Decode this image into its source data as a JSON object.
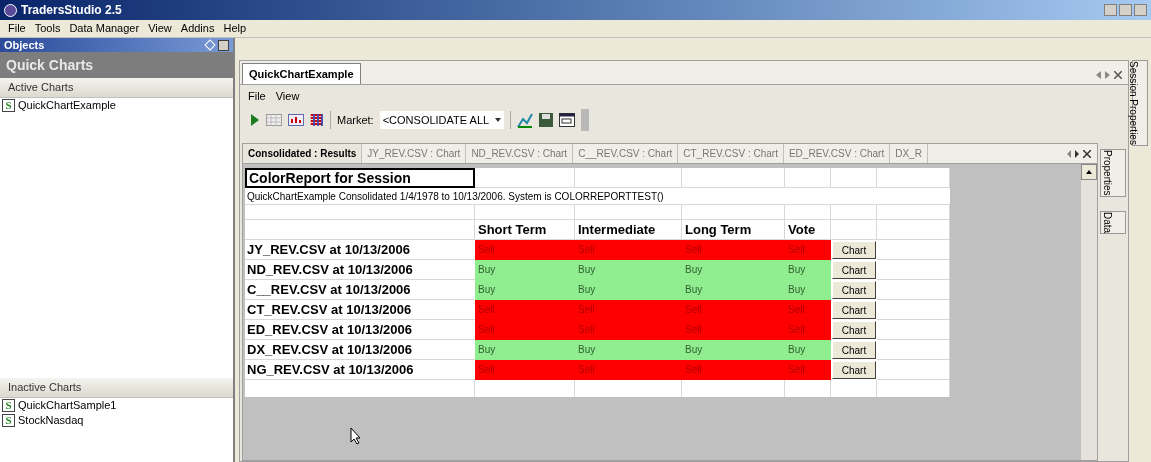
{
  "window": {
    "title": "TradersStudio 2.5"
  },
  "menu": [
    "File",
    "Tools",
    "Data Manager",
    "View",
    "Addins",
    "Help"
  ],
  "objects_panel": {
    "title": "Objects",
    "heading": "Quick Charts",
    "sections": [
      {
        "title": "Active Charts",
        "items": [
          {
            "label": "QuickChartExample",
            "badge": "S"
          }
        ]
      },
      {
        "title": "Inactive Charts",
        "items": [
          {
            "label": "QuickChartSample1",
            "badge": "S"
          },
          {
            "label": "StockNasdaq",
            "badge": "S"
          }
        ]
      }
    ]
  },
  "document_tab": {
    "label": "QuickChartExample",
    "selected": true
  },
  "document_menu": [
    "File",
    "View"
  ],
  "toolbar": {
    "market_label": "Market:",
    "market_value": "<CONSOLIDATE ALL"
  },
  "result_tabs": [
    {
      "label": "Consolidated : Results",
      "selected": true
    },
    {
      "label": "JY_REV.CSV : Chart",
      "selected": false
    },
    {
      "label": "ND_REV.CSV : Chart",
      "selected": false
    },
    {
      "label": "C__REV.CSV : Chart",
      "selected": false
    },
    {
      "label": "CT_REV.CSV : Chart",
      "selected": false
    },
    {
      "label": "ED_REV.CSV : Chart",
      "selected": false
    },
    {
      "label": "DX_R",
      "selected": false
    }
  ],
  "report": {
    "title": "ColorReport for Session",
    "subtitle": "QuickChartExample Consolidated 1/4/1978 to 10/13/2006. System is COLORREPORTTEST()",
    "columns": [
      "Short Term",
      "Intermediate",
      "Long Term",
      "Vote"
    ],
    "rows": [
      {
        "label": "JY_REV.CSV at 10/13/2006",
        "kind": "sell",
        "cells": [
          "Sell",
          "Sell",
          "Sell",
          "Sell"
        ],
        "button": "Chart"
      },
      {
        "label": "ND_REV.CSV at 10/13/2006",
        "kind": "buy",
        "cells": [
          "Buy",
          "Buy",
          "Buy",
          "Buy"
        ],
        "button": "Chart"
      },
      {
        "label": "C__REV.CSV at 10/13/2006",
        "kind": "buy",
        "cells": [
          "Buy",
          "Buy",
          "Buy",
          "Buy"
        ],
        "button": "Chart"
      },
      {
        "label": "CT_REV.CSV at 10/13/2006",
        "kind": "sell",
        "cells": [
          "Sell",
          "Sell",
          "Sell",
          "Sell"
        ],
        "button": "Chart"
      },
      {
        "label": "ED_REV.CSV at 10/13/2006",
        "kind": "sell",
        "cells": [
          "Sell",
          "Sell",
          "Sell",
          "Sell"
        ],
        "button": "Chart"
      },
      {
        "label": "DX_REV.CSV at 10/13/2006",
        "kind": "buy",
        "cells": [
          "Buy",
          "Buy",
          "Buy",
          "Buy"
        ],
        "button": "Chart"
      },
      {
        "label": "NG_REV.CSV at 10/13/2006",
        "kind": "sell",
        "cells": [
          "Sell",
          "Sell",
          "Sell",
          "Sell"
        ],
        "button": "Chart"
      }
    ]
  },
  "side_tabs": [
    "Properties",
    "Data"
  ],
  "outer_side_tab": "Session Properties"
}
